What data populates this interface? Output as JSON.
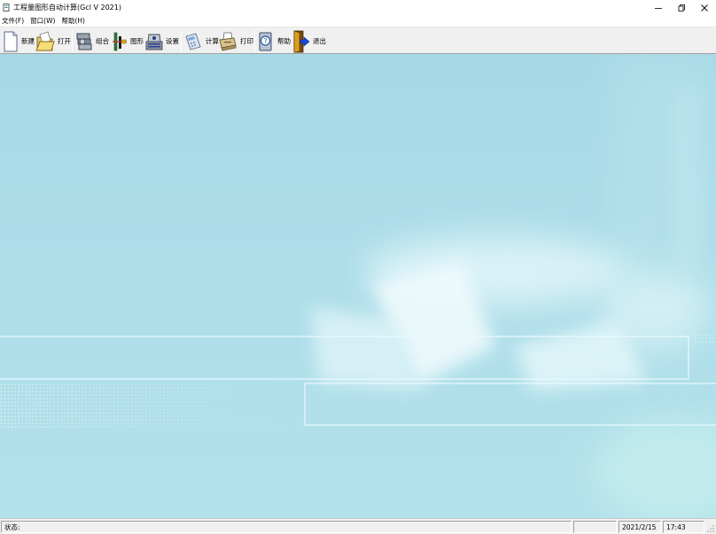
{
  "window": {
    "title": "工程量图形自动计算(Gcl V 2021)",
    "icon": "app-document-icon"
  },
  "menu": [
    {
      "label": "文件(F)"
    },
    {
      "label": "窗口(W)"
    },
    {
      "label": "帮助(H)"
    }
  ],
  "toolbar": {
    "new_label": "新建",
    "open_label": "打开",
    "combine_label": "组合",
    "graphic_label": "图形",
    "settings_label": "设置",
    "calculate_label": "计算",
    "print_label": "打印",
    "help_label": "帮助",
    "exit_label": "退出"
  },
  "statusbar": {
    "status": "状态:",
    "date": "2021/2/15",
    "time": "17:43"
  }
}
